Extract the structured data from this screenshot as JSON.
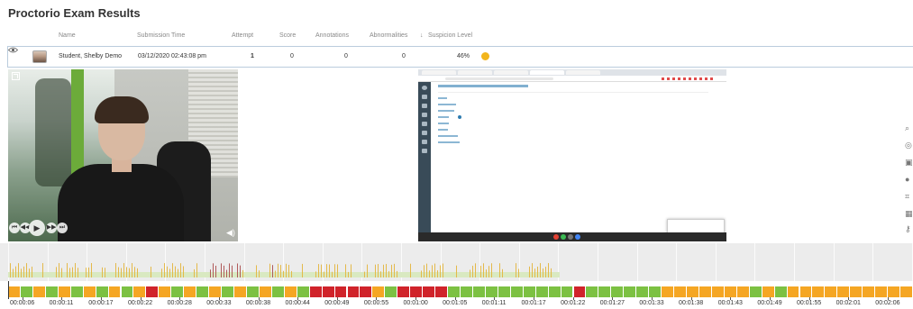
{
  "page": {
    "title": "Proctorio Exam Results"
  },
  "table": {
    "headers": [
      "Name",
      "Submission Time",
      "Attempt",
      "Score",
      "Annotations",
      "Abnormalities",
      "Suspicion Level"
    ],
    "sort_icon": "arrow-down-icon",
    "row": {
      "name": "Student, Shelby Demo",
      "submission_time": "03/12/2020 02:43:08 pm",
      "attempt": "1",
      "score": "0",
      "annotations": "0",
      "abnormalities": "0",
      "suspicion_level": "46%",
      "suspicion_color": "#f2b51c",
      "view_icon": "eye-icon"
    }
  },
  "webcam": {
    "popout_icon": "popout-icon",
    "controls": [
      "previous-icon",
      "rewind-icon",
      "play-icon",
      "forward-icon",
      "next-icon"
    ],
    "volume_icon": "volume-icon"
  },
  "tools": [
    "search-icon",
    "target-icon",
    "screen-icon",
    "globe-icon",
    "network-icon",
    "calendar-icon",
    "key-icon"
  ],
  "timeline": {
    "segments": [
      "o",
      "g",
      "o",
      "g",
      "o",
      "g",
      "o",
      "g",
      "o",
      "g",
      "o",
      "r",
      "o",
      "g",
      "o",
      "g",
      "o",
      "g",
      "o",
      "g",
      "o",
      "g",
      "o",
      "g",
      "r",
      "r",
      "r",
      "r",
      "r",
      "o",
      "g",
      "r",
      "r",
      "r",
      "r",
      "g",
      "g",
      "g",
      "g",
      "g",
      "g",
      "g",
      "g",
      "g",
      "g",
      "r",
      "g",
      "g",
      "g",
      "g",
      "g",
      "g",
      "o",
      "o",
      "o",
      "o",
      "o",
      "o",
      "o",
      "g",
      "o",
      "g",
      "o",
      "o",
      "o",
      "o",
      "o",
      "o",
      "o",
      "o",
      "o",
      "o"
    ],
    "colors": {
      "g": "#7cc142",
      "o": "#f5a623",
      "r": "#d0232a"
    },
    "ticks": [
      "00:00:06",
      "00:00:11",
      "00:00:17",
      "00:00:22",
      "00:00:28",
      "00:00:33",
      "00:00:38",
      "00:00:44",
      "00:00:49",
      "00:00:55",
      "00:01:00",
      "00:01:05",
      "00:01:11",
      "00:01:17",
      "00:01:22",
      "00:01:27",
      "00:01:33",
      "00:01:38",
      "00:01:43",
      "00:01:49",
      "00:01:55",
      "00:02:01",
      "00:02:06"
    ]
  }
}
